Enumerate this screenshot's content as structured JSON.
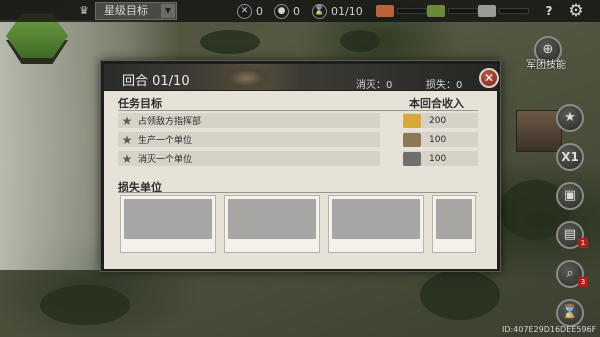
{
  "topbar": {
    "trophy_icon": "trophy-icon",
    "objective_select": "星级目标",
    "kills": "0",
    "losses": "0",
    "turns": "01/10",
    "resources": [
      {
        "name": "steel-icon",
        "color": "#b8643a"
      },
      {
        "name": "ammo-icon",
        "color": "#6a8a3a"
      },
      {
        "name": "oil-icon",
        "color": "#9a9a96"
      }
    ],
    "help": "?",
    "settings_icon": "gear-icon"
  },
  "side": {
    "legion_skill_label": "军团技能",
    "speed_label": "X1",
    "badge_1": "1",
    "badge_2": "3"
  },
  "dialog": {
    "round_label": "回合 01/10",
    "eliminate_label": "消灭：0",
    "lost_label": "损失：0",
    "task_title": "任务目标",
    "income_title": "本回合收入",
    "tasks": [
      {
        "label": "占领敌方指挥部"
      },
      {
        "label": "生产一个单位"
      },
      {
        "label": "消灭一个单位"
      }
    ],
    "income": [
      {
        "icon": "gold-icon",
        "color": "#d9a83a",
        "value": "200"
      },
      {
        "icon": "oil-barrel-icon",
        "color": "#8b7a55",
        "value": "100"
      },
      {
        "icon": "steel-icon",
        "color": "#6f6f6b",
        "value": "100"
      }
    ],
    "lost_units_title": "损失单位",
    "lost_slots": 4
  },
  "footer": {
    "id_text": "ID:407E29D16DEE596F"
  }
}
